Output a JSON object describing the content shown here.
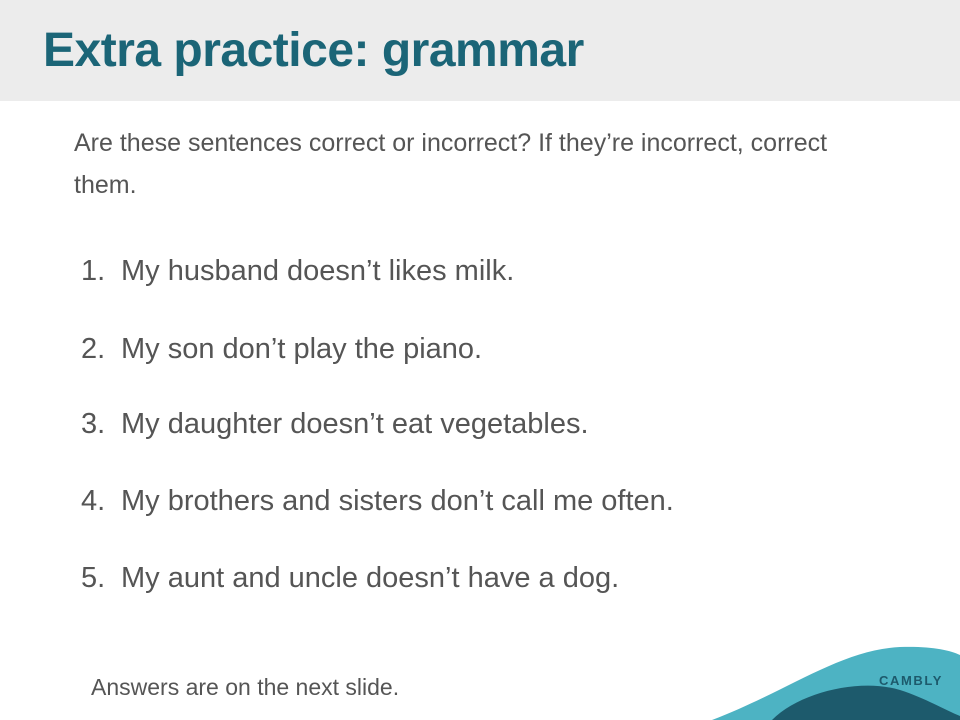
{
  "slide": {
    "title": "Extra practice: grammar",
    "instructions": "Are these sentences correct or incorrect? If they’re incorrect, correct them.",
    "items": [
      {
        "number": "1.",
        "text": "My husband doesn’t likes milk."
      },
      {
        "number": "2.",
        "text": "My son don’t play the piano."
      },
      {
        "number": "3.",
        "text": "My daughter doesn’t eat vegetables."
      },
      {
        "number": "4.",
        "text": "My brothers and sisters don’t call me often."
      },
      {
        "number": "5.",
        "text": "My aunt and uncle doesn’t have a dog."
      }
    ],
    "footer_note": "Answers are on the next slide."
  },
  "brand": {
    "name": "CAMBLY",
    "colors": {
      "title": "#1b6577",
      "wave_light": "#4db3c3",
      "wave_dark": "#1d5a6c",
      "header_bg": "#ececec"
    }
  }
}
